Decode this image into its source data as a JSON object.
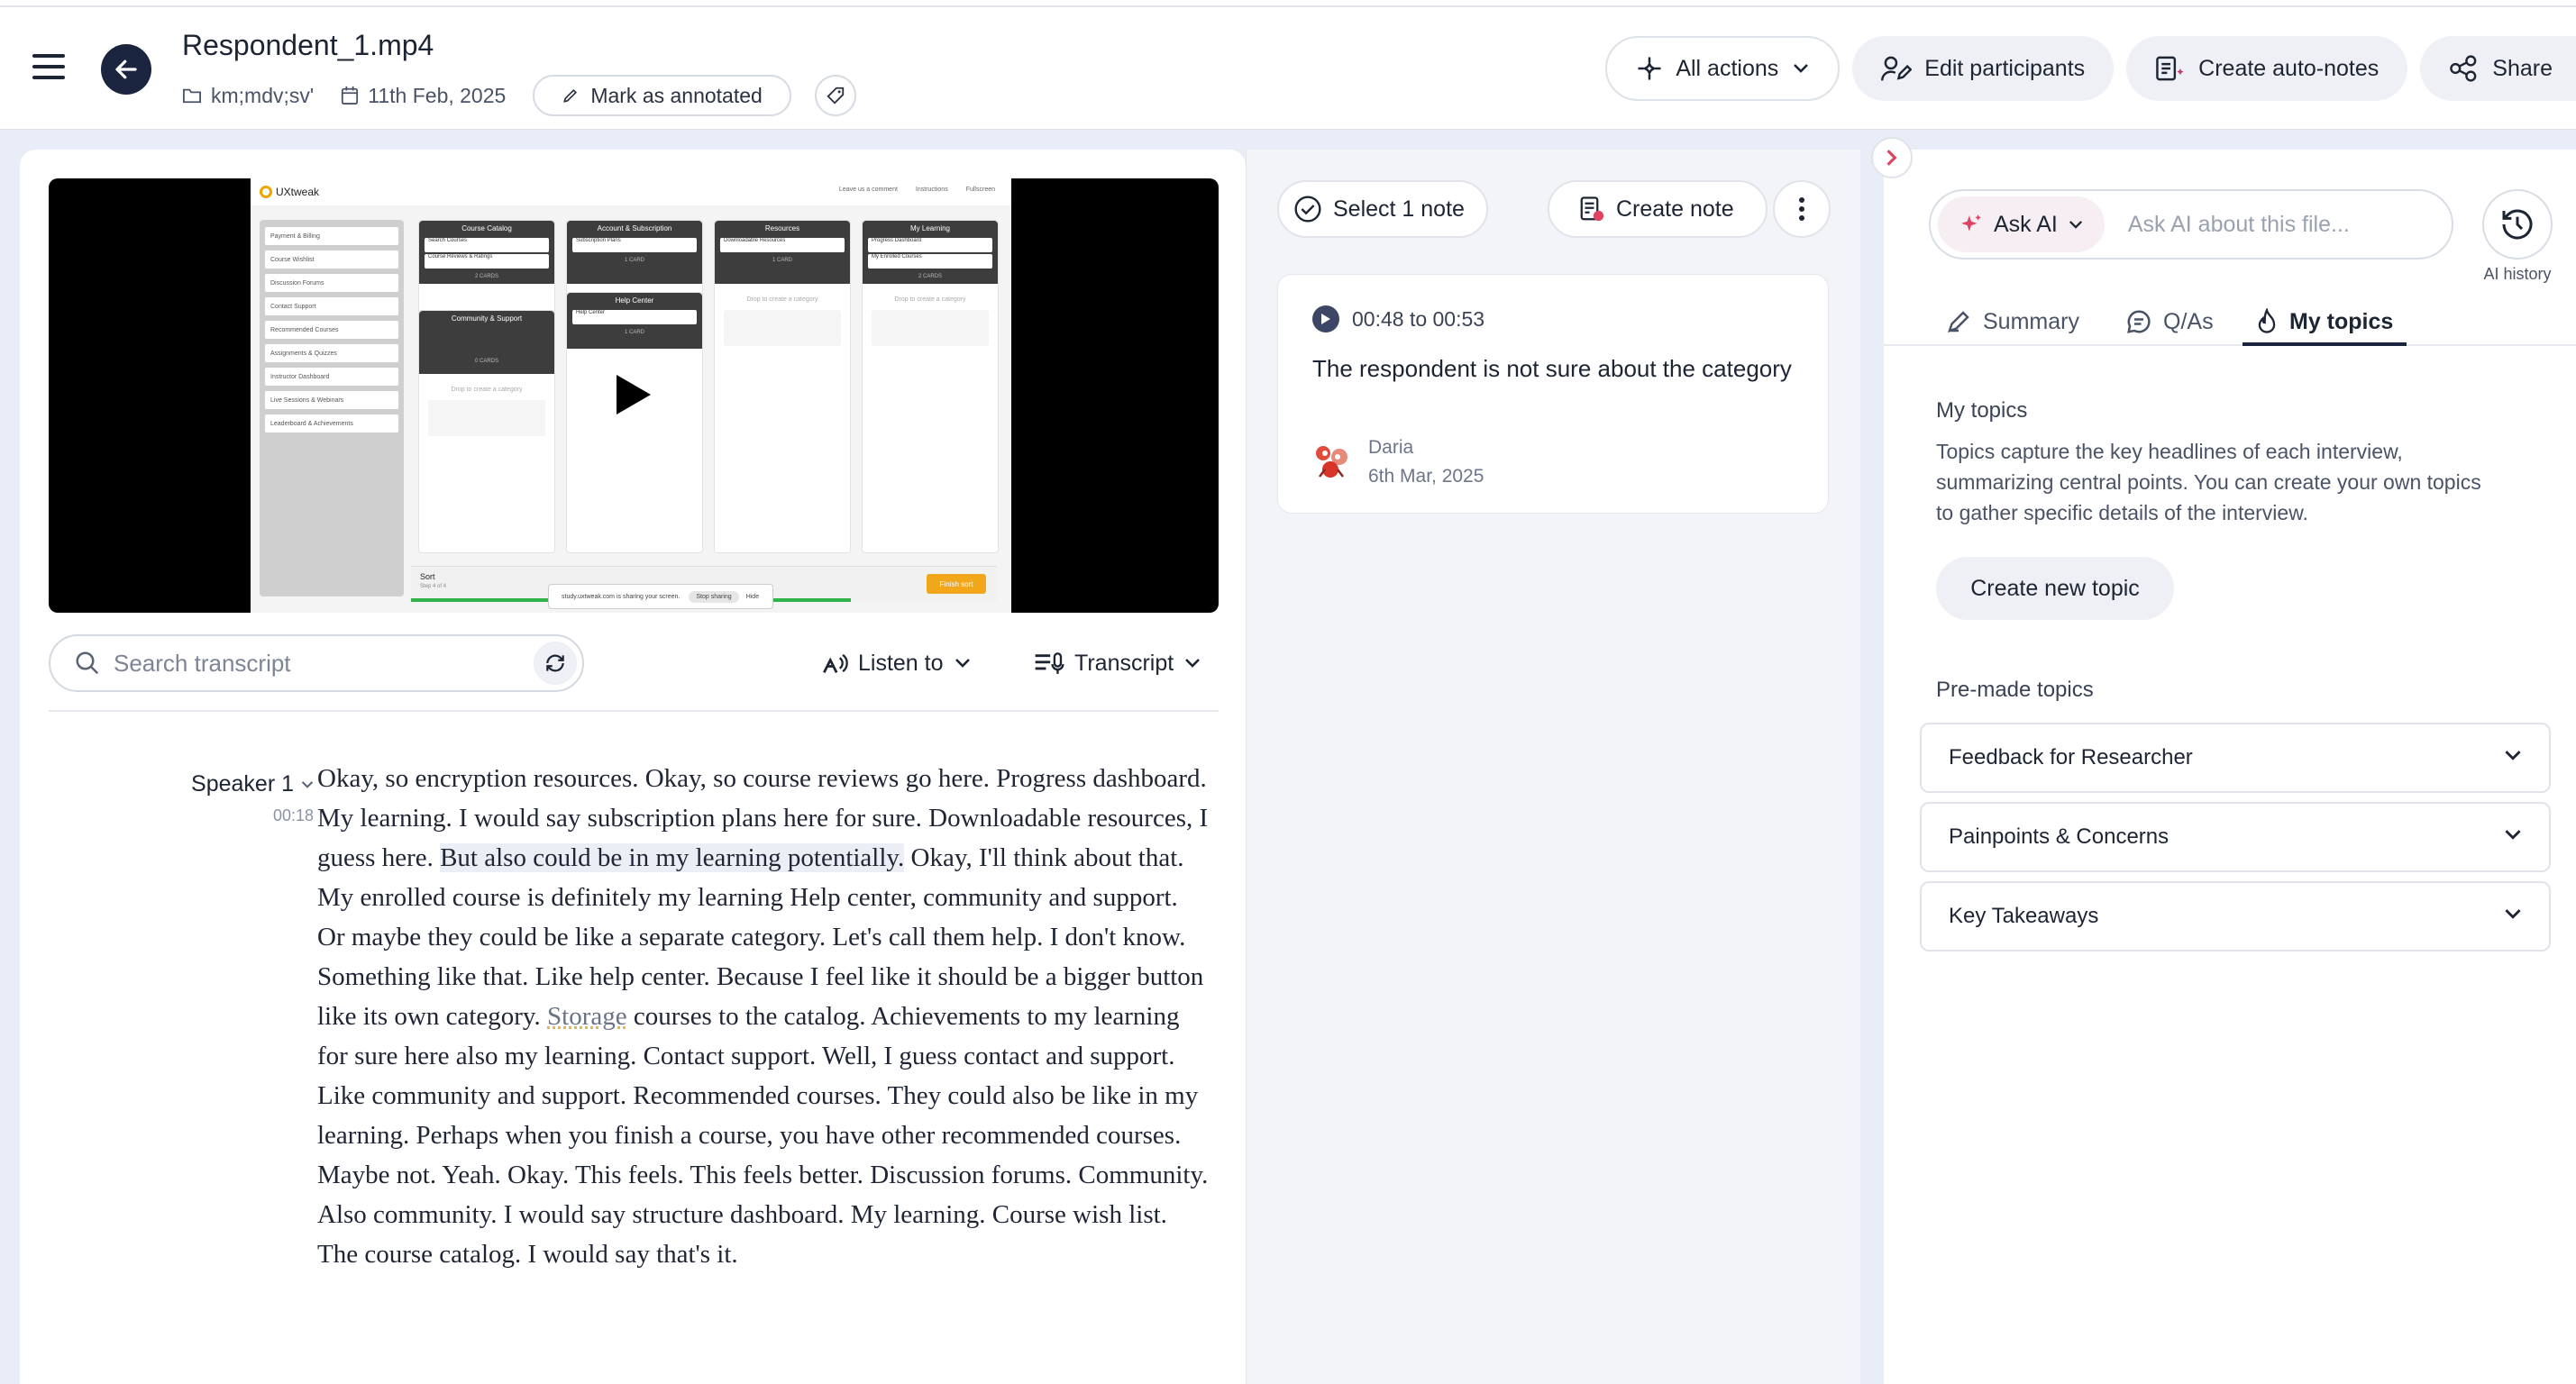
{
  "header": {
    "file_title": "Respondent_1.mp4",
    "folder": "km;mdv;sv'",
    "date": "11th Feb, 2025",
    "mark_annotated": "Mark as annotated",
    "all_actions": "All actions",
    "edit_participants": "Edit participants",
    "create_auto_notes": "Create auto-notes",
    "share": "Share"
  },
  "video": {
    "screen_logo": "UXtweak",
    "screen_top_links": [
      "Leave us a comment",
      "Instructions",
      "Fullscreen"
    ],
    "sidebar_cards": [
      "Payment & Billing",
      "Course Wishlist",
      "Discussion Forums",
      "Contact Support",
      "Recommended Courses",
      "Assignments & Quizzes",
      "Instructor Dashboard",
      "Live Sessions & Webinars",
      "Leaderboard & Achievements"
    ],
    "columns": [
      {
        "title": "Course Catalog",
        "items": [
          "Search Courses",
          "Course Reviews & Ratings"
        ],
        "count": "2 CARDS"
      },
      {
        "title": "Account & Subscription",
        "items": [
          "Subscription Plans"
        ],
        "count": "1 CARD"
      },
      {
        "title": "Resources",
        "items": [
          "Downloadable Resources"
        ],
        "count": "1 CARD"
      },
      {
        "title": "My Learning",
        "items": [
          "Progress Dashboard",
          "My Enrolled Courses"
        ],
        "count": "2 CARDS"
      }
    ],
    "column_lower": [
      {
        "title": "Community & Support",
        "count": "0 CARDS"
      },
      {
        "title": "Help Center",
        "items": [
          "Help Center"
        ],
        "count": "1 CARD"
      }
    ],
    "drop_text": "Drop to create a category",
    "sort_label": "Sort",
    "sort_step": "Step 4 of 4",
    "finish_sort": "Finish sort",
    "sharing_text": "study.uxtweak.com is sharing your screen.",
    "stop_sharing": "Stop sharing",
    "hide": "Hide",
    "progress": 0.75
  },
  "transcript_controls": {
    "search_placeholder": "Search transcript",
    "listen_to": "Listen to",
    "transcript": "Transcript"
  },
  "transcript": {
    "speaker": "Speaker 1",
    "time": "00:18",
    "text_before_hl": "Okay, so encryption resources. Okay, so course reviews go here. Progress dashboard. My learning. I would say subscription plans here for sure. Downloadable resources, I guess here. ",
    "highlighted": "But also could be in my learning potentially.",
    "text_mid": " Okay, I'll think about that. My enrolled course is definitely my learning Help center, community and support. Or maybe they could be like a separate category. Let's call them help. I don't know. Something like that. Like help center. Because I feel like it should be a bigger button like its own category. ",
    "misspelled": "Storage",
    "text_after": " courses to the catalog. Achievements to my learning for sure here also my learning. Contact support. Well, I guess contact and support. Like community and support. Recommended courses. They could also be like in my learning. Perhaps when you finish a course, you have other recommended courses. Maybe not. Yeah. Okay. This feels. This feels better. Discussion forums. Community. Also community. I would say structure dashboard. My learning. Course wish list. The course catalog. I would say that's it."
  },
  "notes": {
    "select_note": "Select 1 note",
    "create_note": "Create note",
    "card": {
      "time_range": "00:48 to 00:53",
      "text": "The respondent is not sure about the category",
      "author": "Daria",
      "date": "6th Mar, 2025"
    }
  },
  "ai": {
    "ask_ai": "Ask AI",
    "ask_placeholder": "Ask AI about this file...",
    "history_label": "AI history",
    "tabs": [
      "Summary",
      "Q/As",
      "My topics"
    ],
    "active_tab": "My topics",
    "topics_heading": "My topics",
    "topics_desc": "Topics capture the key headlines of each interview, summarizing central points. You can create your own topics to gather specific details of the interview.",
    "create_topic": "Create new topic",
    "premade_heading": "Pre-made topics",
    "premade": [
      "Feedback for Researcher",
      "Painpoints & Concerns",
      "Key Takeaways"
    ]
  }
}
